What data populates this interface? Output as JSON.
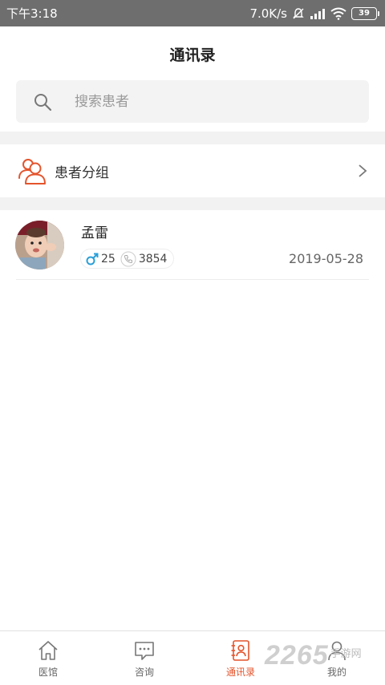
{
  "status_bar": {
    "time": "下午3:18",
    "network_speed": "7.0K/s",
    "battery": "39"
  },
  "header": {
    "title": "通讯录"
  },
  "search": {
    "placeholder": "搜索患者"
  },
  "group": {
    "label": "患者分组"
  },
  "patients": [
    {
      "name": "孟雷",
      "age": "25",
      "phone_suffix": "3854",
      "date": "2019-05-28",
      "gender": "male"
    }
  ],
  "tabbar": {
    "items": [
      {
        "label": "医馆",
        "icon": "home-icon"
      },
      {
        "label": "咨询",
        "icon": "chat-icon"
      },
      {
        "label": "通讯录",
        "icon": "contacts-icon",
        "active": true
      },
      {
        "label": "我的",
        "icon": "user-icon"
      }
    ]
  },
  "watermark": {
    "number": "2265",
    "text": "手游网"
  },
  "colors": {
    "accent": "#e4542c",
    "male": "#2a9fd8",
    "statusbar": "#6e6e6e"
  }
}
